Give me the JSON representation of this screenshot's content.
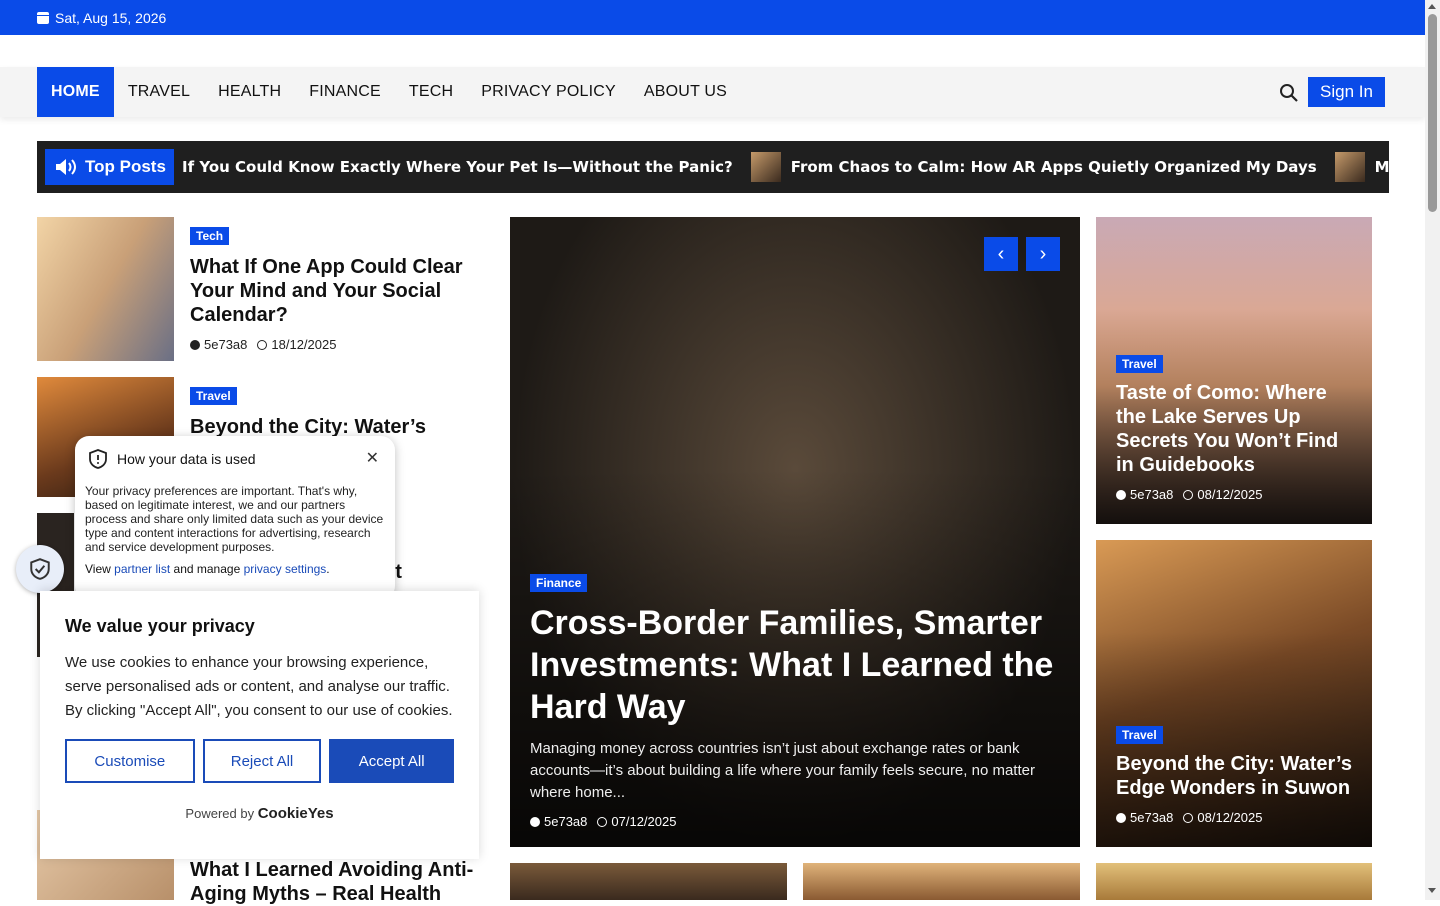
{
  "topbar": {
    "date": "Sat, Aug 15, 2026"
  },
  "nav": {
    "items": [
      "HOME",
      "TRAVEL",
      "HEALTH",
      "FINANCE",
      "TECH",
      "PRIVACY POLICY",
      "ABOUT US"
    ],
    "sign_in": "Sign In"
  },
  "ticker": {
    "label": "Top Posts",
    "items": [
      "If You Could Know Exactly Where Your Pet Is—Without the Panic?",
      "From Chaos to Calm: How AR Apps Quietly Organized My Days",
      "More than"
    ]
  },
  "left_posts": [
    {
      "tag": "Tech",
      "title": "What If One App Could Clear Your Mind and Your Social Calendar?",
      "author": "5e73a8",
      "date": "18/12/2025"
    },
    {
      "tag": "Travel",
      "title": "Beyond the City: Water’s Edge",
      "author": "",
      "date": ""
    },
    {
      "tag": "",
      "title": "the Lake Won’t",
      "author": "",
      "date": ""
    },
    {
      "tag": "",
      "title": "What I Learned Avoiding Anti-Aging Myths – Real Health",
      "author": "",
      "date": ""
    }
  ],
  "hero": {
    "tag": "Finance",
    "title": "Cross-Border Families, Smarter Investments: What I Learned the Hard Way",
    "excerpt": "Managing money across countries isn’t just about exchange rates or bank accounts—it’s about building a life where your family feels secure, no matter where home...",
    "author": "5e73a8",
    "date": "07/12/2025"
  },
  "right_posts": [
    {
      "tag": "Travel",
      "title": "Taste of Como: Where the Lake Serves Up Secrets You Won’t Find in Guidebooks",
      "author": "5e73a8",
      "date": "08/12/2025"
    },
    {
      "tag": "Travel",
      "title": "Beyond the City: Water’s Edge Wonders in Suwon",
      "author": "5e73a8",
      "date": "08/12/2025"
    }
  ],
  "privacy_popup": {
    "title": "How your data is used",
    "text": "Your privacy preferences are important. That's why, based on legitimate interest, we and our partners process and share only limited data such as your device type and content interactions for advertising, research and service development purposes.",
    "view": "View",
    "partner_link": "partner list",
    "and_manage": "and manage",
    "settings_link": "privacy settings",
    "period": "."
  },
  "cookie": {
    "title": "We value your privacy",
    "text": "We use cookies to enhance your browsing experience, serve personalised ads or content, and analyse our traffic. By clicking \"Accept All\", you consent to our use of cookies.",
    "customise": "Customise",
    "reject": "Reject All",
    "accept": "Accept All",
    "powered": "Powered by",
    "brand": "CookieYes"
  },
  "colors": {
    "accent": "#0a4be8",
    "ticker_bg": "#1f1f1f",
    "cookie_button": "#1a4bb8"
  }
}
